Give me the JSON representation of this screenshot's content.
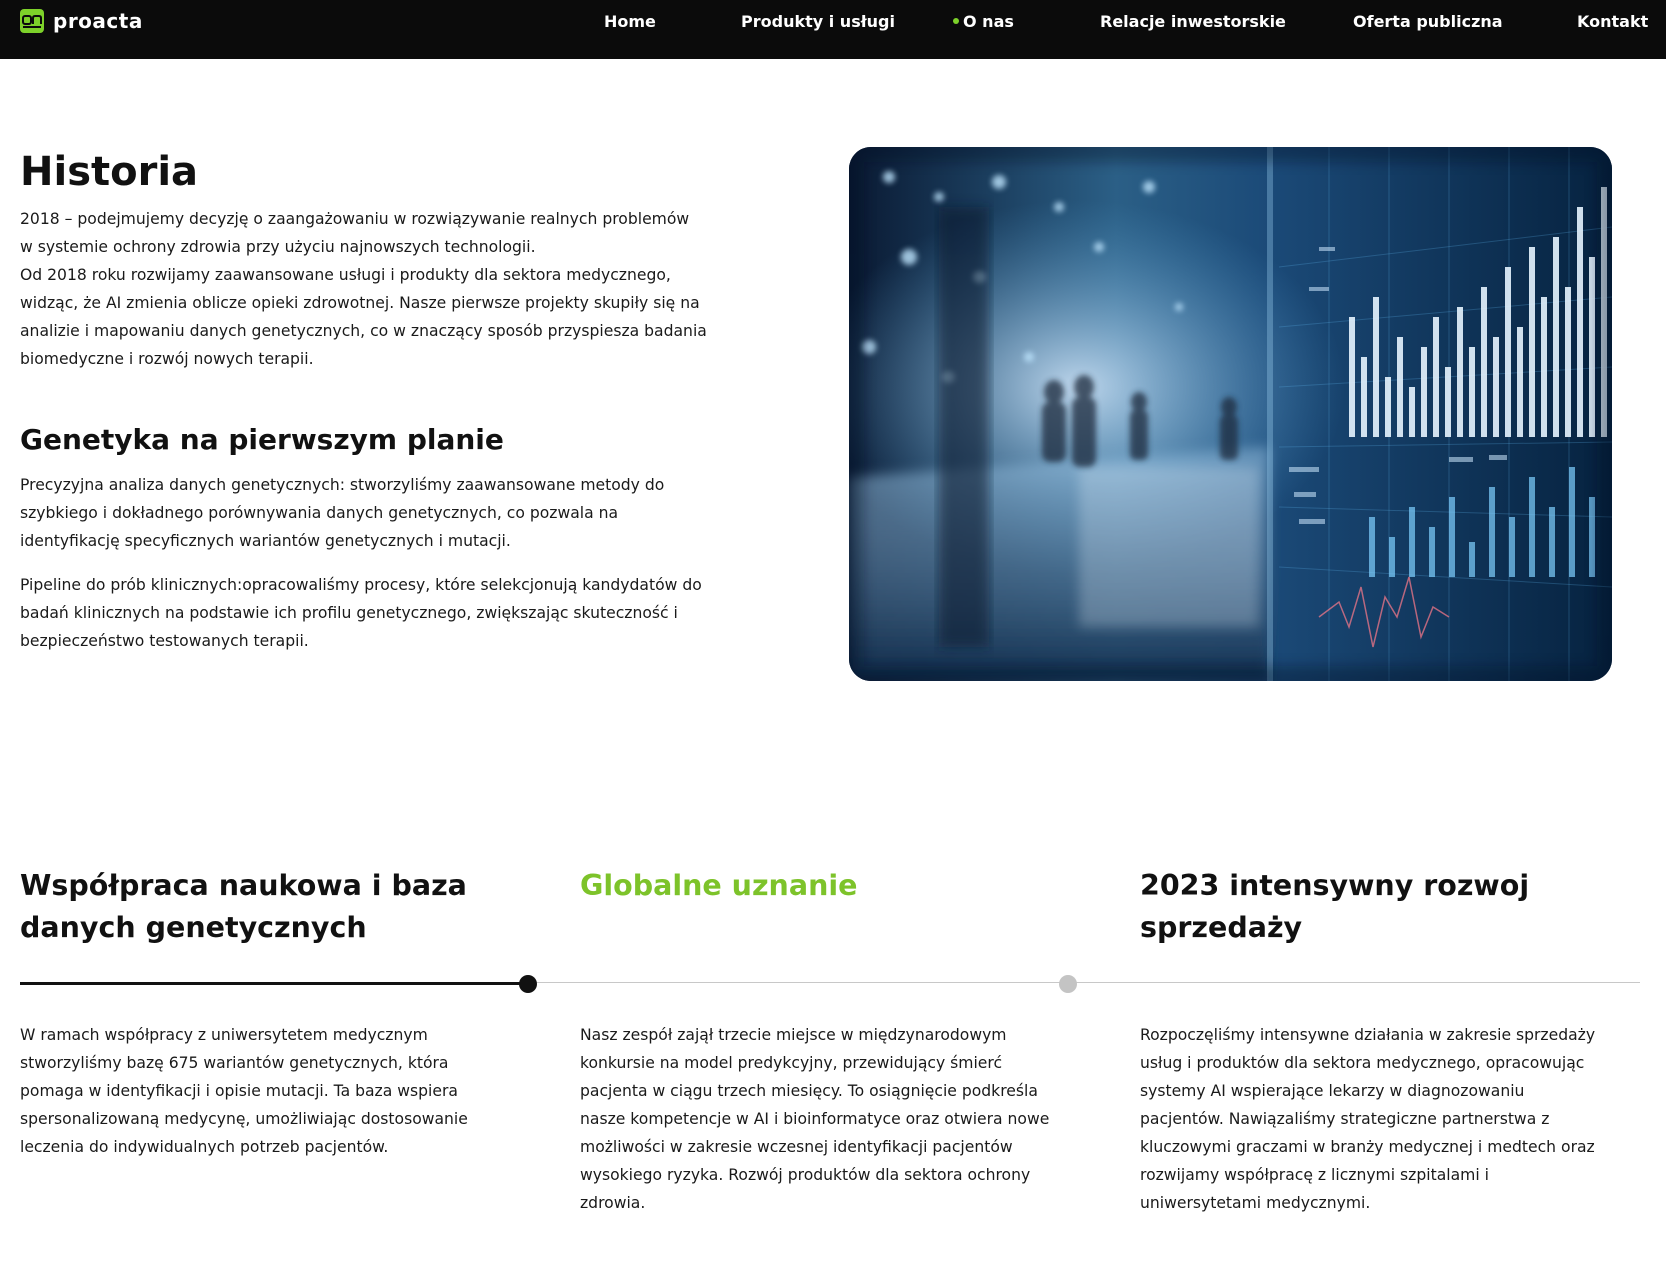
{
  "brand": {
    "name": "proacta",
    "accent": "#7dd12a",
    "header_bg": "#0b0b0b"
  },
  "nav": {
    "items": [
      {
        "label": "Home"
      },
      {
        "label": "Produkty i usługi"
      },
      {
        "label": "O nas",
        "active": true
      },
      {
        "label": "Relacje inwestorskie"
      },
      {
        "label": "Oferta publiczna"
      },
      {
        "label": "Kontakt"
      }
    ]
  },
  "history": {
    "title": "Historia",
    "line1": "2018 – podejmujemy decyzję o zaangażowaniu w rozwiązywanie realnych problemów",
    "line2": "w systemie ochrony zdrowia przy użyciu najnowszych technologii.",
    "intro": "Od 2018 roku rozwijamy zaawansowane usługi i produkty dla sektora medycznego, widząc, że AI zmienia oblicze opieki zdrowotnej. Nasze pierwsze projekty skupiły się na analizie i mapowaniu danych genetycznych, co w znaczący sposób przyspiesza badania biomedyczne i rozwój nowych terapii."
  },
  "genetics": {
    "title": "Genetyka na pierwszym planie",
    "p1": "Precyzyjna analiza danych genetycznych: stworzyliśmy zaawansowane metody do szybkiego i dokładnego porównywania danych genetycznych, co pozwala na identyfikację specyficznych wariantów genetycznych i mutacji.",
    "p2": "Pipeline do prób klinicznych:opracowaliśmy procesy, które selekcjonują kandydatów do badań klinicznych na podstawie ich profilu genetycznego, zwiększając skuteczność i bezpieczeństwo testowanych terapii."
  },
  "milestones": [
    {
      "title": "Współpraca naukowa i baza danych genetycznych",
      "text": "W ramach współpracy z uniwersytetem medycznym stworzyliśmy bazę 675 wariantów genetycznych, która pomaga w identyfikacji i opisie mutacji. Ta baza wspiera spersonalizowaną medycynę, umożliwiając dostosowanie leczenia do indywidualnych potrzeb pacjentów."
    },
    {
      "title": "Globalne uznanie",
      "text": "Nasz zespół zajął trzecie miejsce w międzynarodowym konkursie na model predykcyjny, przewidujący śmierć pacjenta w ciągu trzech miesięcy. To osiągnięcie podkreśla nasze kompetencje w AI i bioinformatyce oraz otwiera nowe możliwości w zakresie wczesnej identyfikacji pacjentów wysokiego ryzyka. Rozwój produktów dla sektora ochrony zdrowia."
    },
    {
      "title": "2023 intensywny rozwoj sprzedaży",
      "text": "Rozpoczęliśmy intensywne działania w zakresie sprzedaży usług i produktów dla sektora medycznego, opracowując systemy AI wspierające lekarzy w diagnozowaniu pacjentów. Nawiązaliśmy strategiczne partnerstwa z kluczowymi graczami w branży medycznej i medtech oraz rozwijamy współpracę z licznymi szpitalami i uniwersytetami medycznymi."
    }
  ],
  "timeline": {
    "active_color": "#111111",
    "inactive_color": "#c4c4c4",
    "line_color": "#c8c8c8"
  }
}
